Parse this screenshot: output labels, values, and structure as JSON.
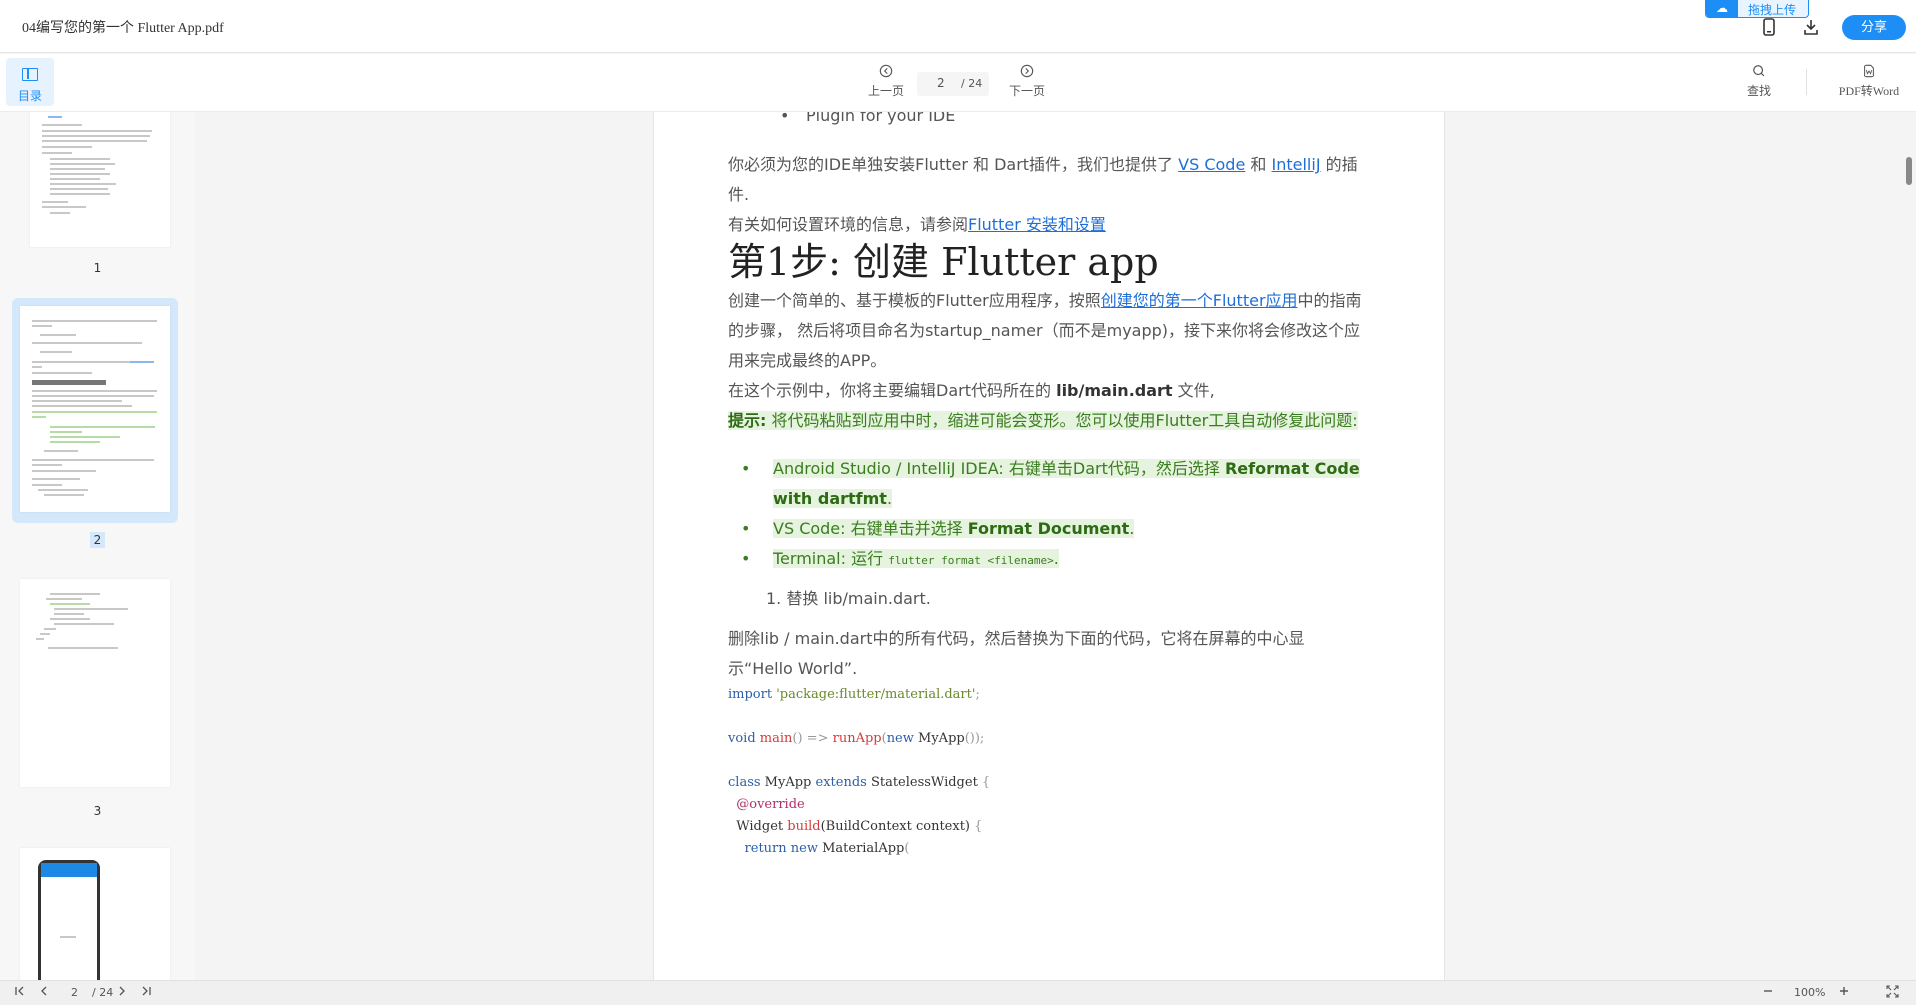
{
  "header": {
    "file_title": "04编写您的第一个 Flutter App.pdf",
    "drag_upload": "拖拽上传",
    "share": "分享"
  },
  "toolbar": {
    "toc_label": "目录",
    "prev_label": "上一页",
    "next_label": "下一页",
    "page_current": "2",
    "page_total": "/ 24",
    "find_label": "查找",
    "pdf_to_word_label": "PDF转Word"
  },
  "sidebar": {
    "thumbnails": [
      {
        "number": "1"
      },
      {
        "number": "2",
        "selected": true
      },
      {
        "number": "3"
      }
    ]
  },
  "document": {
    "bullet_top": "Plugin for your IDE",
    "para1_a": "你必须为您的IDE单独安装Flutter 和 Dart插件，我们也提供了 ",
    "para1_link1": "VS Code",
    "para1_b": " 和 ",
    "para1_link2": "IntelliJ",
    "para1_c": " 的插件.",
    "para2_a": "有关如何设置环境的信息，请参阅",
    "para2_link": "Flutter 安装和设置",
    "heading": "第1步: 创建 Flutter app",
    "para3_a": "创建一个简单的、基于模板的Flutter应用程序，按照",
    "para3_link": "创建您的第一个Flutter应用",
    "para3_b": "中的指南的步骤， 然后将项目命名为startup_namer（而不是myapp)，接下来你将会修改这个应用来完成最终的APP。",
    "para4_a": "在这个示例中，你将主要编辑Dart代码所在的 ",
    "para4_bold": "lib/main.dart",
    "para4_b": " 文件,",
    "tip_label": "提示:",
    "tip_text": " 将代码粘贴到应用中时，缩进可能会变形。您可以使用Flutter工具自动修复此问题:",
    "tips": [
      {
        "text": "Android Studio / IntelliJ IDEA: 右键单击Dart代码，然后选择 ",
        "bold": "Reformat Code with dartfmt",
        "suffix": "."
      },
      {
        "text": "VS Code: 右键单击并选择 ",
        "bold": "Format Document",
        "suffix": "."
      },
      {
        "text": "Terminal: 运行 ",
        "code": "flutter format <filename>",
        "suffix": "."
      }
    ],
    "step1": "1. 替换 lib/main.dart.",
    "para5": "删除lib / main.dart中的所有代码，然后替换为下面的代码，它将在屏幕的中心显示“Hello World”.",
    "code": {
      "l1_kw": "import",
      "l1_str": "'package:flutter/material.dart'",
      "l1_end": ";",
      "l2_kw": "void",
      "l2_fn": "main",
      "l2_mid": "() => ",
      "l2_fn2": "runApp",
      "l2_p1": "(",
      "l2_kw2": "new",
      "l2_cls": " MyApp",
      "l2_end": "());",
      "l3_kw": "class",
      "l3_name": " MyApp ",
      "l3_kw2": "extends",
      "l3_sup": " StatelessWidget ",
      "l3_br": "{",
      "l4_ann": "@override",
      "l5_type": "Widget ",
      "l5_fn": "build",
      "l5_args": "(BuildContext context) ",
      "l5_br": "{",
      "l6_kw": "return",
      "l6_kw2": " new",
      "l6_cls": " MaterialApp",
      "l6_p": "("
    }
  },
  "statusbar": {
    "page_current": "2",
    "page_total": "/ 24",
    "zoom": "100%"
  },
  "colors": {
    "accent": "#1e8ef7",
    "tip_green": "#3a7d1f",
    "tip_bg": "#e6f3df",
    "link": "#1e6fd9"
  }
}
